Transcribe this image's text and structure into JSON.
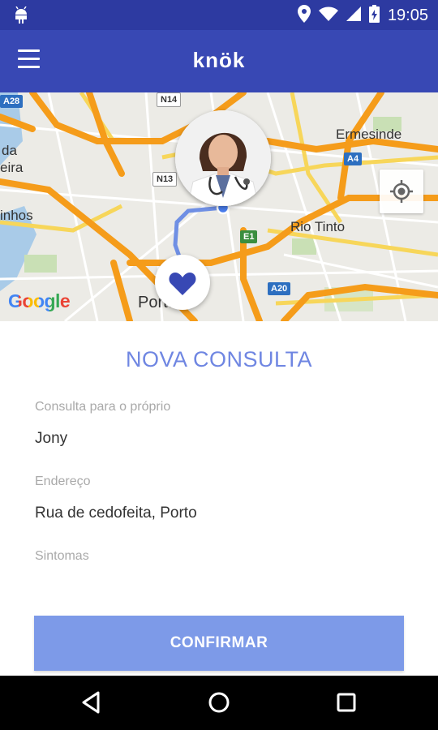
{
  "status_bar": {
    "time": "19:05",
    "icons": [
      "android-icon",
      "location-icon",
      "wifi-icon",
      "signal-icon",
      "battery-icon"
    ]
  },
  "app_bar": {
    "title": "knök",
    "menu_icon": "hamburger-menu-icon",
    "color": "#3848b4",
    "status_color": "#2d3aa1"
  },
  "map": {
    "labels": {
      "ermesinde": "Ermesinde",
      "rio_tinto": "Rio Tinto",
      "porto": "Porto",
      "da": "da",
      "eira": "eira",
      "inhos": "inhos"
    },
    "badges": {
      "a28": "A28",
      "n14": "N14",
      "n13": "N13",
      "a4": "A4",
      "e1": "E1",
      "a20": "A20"
    },
    "attribution": "Google",
    "locate_icon": "my-location-icon",
    "marker_icon": "heart-icon",
    "avatar": "doctor-avatar"
  },
  "form": {
    "title": "NOVA CONSULTA",
    "fields": [
      {
        "label": "Consulta para o próprio",
        "value": "Jony"
      },
      {
        "label": "Endereço",
        "value": "Rua de cedofeita, Porto"
      },
      {
        "label": "Sintomas",
        "value": ""
      }
    ],
    "confirm_label": "CONFIRMAR",
    "accent": "#6f86e2",
    "button_color": "#7d9ae8"
  },
  "nav_bar": {
    "icons": [
      "back-icon",
      "home-icon",
      "recents-icon"
    ]
  }
}
